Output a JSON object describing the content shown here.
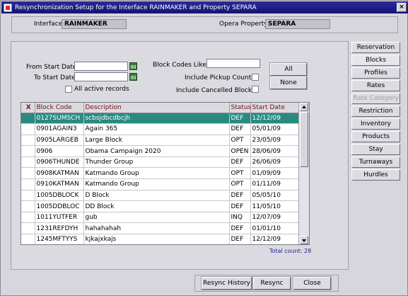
{
  "window": {
    "title": "Resynchronization Setup for the Interface RAINMAKER and Property SEPARA",
    "close_glyph": "×"
  },
  "header": {
    "interface_label": "Interface",
    "interface_value": "RAINMAKER",
    "property_label": "Opera Property",
    "property_value": "SEPARA"
  },
  "filters": {
    "from_start_date_label": "From Start Date",
    "from_start_date_value": "",
    "to_start_date_label": "To Start Date",
    "to_start_date_value": "",
    "all_active_records_label": "All active records",
    "block_codes_like_label": "Block Codes Like",
    "block_codes_like_value": "",
    "include_pickup_counts_label": "Include Pickup Counts",
    "include_cancelled_blocks_label": "Include Cancelled Blocks",
    "all_button": "All",
    "none_button": "None"
  },
  "grid": {
    "columns": [
      "X",
      "Block Code",
      "Description",
      "Status",
      "Start Date"
    ],
    "rows": [
      {
        "x": "",
        "code": "0127SUMSCH",
        "desc": "scbsjdbcdbcjh",
        "status": "DEF",
        "start": "12/12/09"
      },
      {
        "x": "",
        "code": "0901AGAIN3",
        "desc": "Again 365",
        "status": "DEF",
        "start": "05/01/09"
      },
      {
        "x": "",
        "code": "0905LARGEB",
        "desc": "Large Block",
        "status": "OPT",
        "start": "23/05/09"
      },
      {
        "x": "",
        "code": "0906",
        "desc": "Obama Campaign 2020",
        "status": "OPEN",
        "start": "28/06/09"
      },
      {
        "x": "",
        "code": "0906THUNDE",
        "desc": "Thunder Group",
        "status": "DEF",
        "start": "26/06/09"
      },
      {
        "x": "",
        "code": "0908KATMAN",
        "desc": "Katmando Group",
        "status": "OPT",
        "start": "01/09/09"
      },
      {
        "x": "",
        "code": "0910KATMAN",
        "desc": "Katmando Group",
        "status": "OPT",
        "start": "01/11/09"
      },
      {
        "x": "",
        "code": "1005DBLOCK",
        "desc": "D Block",
        "status": "DEF",
        "start": "05/05/10"
      },
      {
        "x": "",
        "code": "1005DDBLOC",
        "desc": "DD Block",
        "status": "DEF",
        "start": "11/05/10"
      },
      {
        "x": "",
        "code": "1011YUTFER",
        "desc": "gub",
        "status": "INQ",
        "start": "12/07/09"
      },
      {
        "x": "",
        "code": "1231REFDYH",
        "desc": "hahahahah",
        "status": "DEF",
        "start": "01/01/10"
      },
      {
        "x": "",
        "code": "1245MFTYYS",
        "desc": "kjkajxkajs",
        "status": "DEF",
        "start": "12/12/09"
      }
    ],
    "selected_index": 0,
    "total_count": "Total count: 28"
  },
  "tabs": [
    {
      "label": "Reservation",
      "state": "normal"
    },
    {
      "label": "Blocks",
      "state": "active"
    },
    {
      "label": "Profiles",
      "state": "normal"
    },
    {
      "label": "Rates",
      "state": "normal"
    },
    {
      "label": "Rate Category",
      "state": "disabled"
    },
    {
      "label": "Restriction",
      "state": "normal"
    },
    {
      "label": "Inventory",
      "state": "normal"
    },
    {
      "label": "Products",
      "state": "normal"
    },
    {
      "label": "Stay",
      "state": "normal"
    },
    {
      "label": "Turnaways",
      "state": "normal"
    },
    {
      "label": "Hurdles",
      "state": "normal"
    }
  ],
  "footer": {
    "resync_history": "Resync History",
    "resync": "Resync",
    "close": "Close"
  },
  "colors": {
    "selected_row": "#2a8a80",
    "header_text": "#7a1010",
    "titlebar": "#1e1e88",
    "total_count": "#1a1aa0"
  }
}
